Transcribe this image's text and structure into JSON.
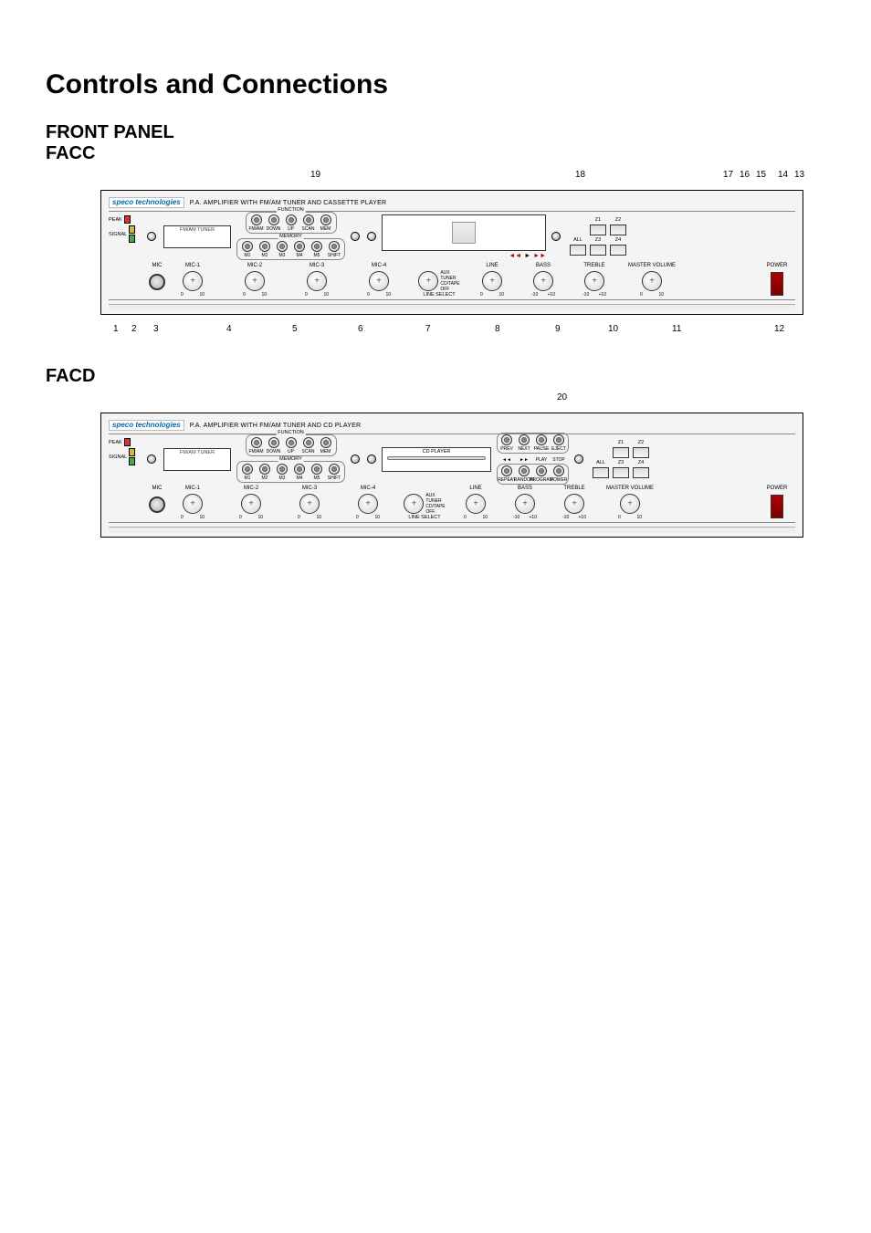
{
  "headings": {
    "title": "Controls and Connections",
    "front_panel": "FRONT PANEL",
    "facc": "FACC",
    "facd": "FACD"
  },
  "logo_text": "speco technologies",
  "facc": {
    "panel_title": "P.A. AMPLIFIER WITH FM/AM TUNER AND CASSETTE PLAYER",
    "callouts_top": [
      "19",
      "18",
      "17",
      "16",
      "15",
      "14",
      "13"
    ],
    "callouts_bottom": [
      "1",
      "2",
      "3",
      "4",
      "5",
      "6",
      "7",
      "8",
      "9",
      "10",
      "11",
      "12"
    ],
    "leds": {
      "peak": "PEAK",
      "signal": "SIGNAL"
    },
    "tuner_label": "FM/AM TUNER",
    "function_group": {
      "label": "FUNCTION",
      "buttons": [
        "FM/AM",
        "DOWN",
        "UP",
        "SCAN",
        "MEM"
      ]
    },
    "memory_group": {
      "label": "MEMORY",
      "buttons": [
        "M1",
        "M2",
        "M3",
        "M4",
        "M5",
        "SHIFT"
      ]
    },
    "transport": [
      "◄◄",
      "►",
      "►►",
      "■"
    ],
    "knobs": {
      "mic_jack": "MIC",
      "mic1": "MIC-1",
      "mic2": "MIC-2",
      "mic3": "MIC-3",
      "mic4": "MIC-4",
      "line_select": "LINE SELECT",
      "line": "LINE",
      "bass": "BASS",
      "treble": "TREBLE",
      "master": "MASTER VOLUME",
      "power": "POWER",
      "aux_labels": [
        "AUX",
        "TUNER",
        "CD/TAPE",
        "OFF"
      ],
      "scale_0_10": [
        "0",
        "10"
      ],
      "scale_pm10": [
        "-10",
        "+10"
      ]
    },
    "zones": {
      "all": "ALL",
      "z1": "Z1",
      "z2": "Z2",
      "z3": "Z3",
      "z4": "Z4"
    }
  },
  "facd": {
    "panel_title": "P.A. AMPLIFIER WITH FM/AM TUNER AND CD PLAYER",
    "callouts_top": [
      "20"
    ],
    "cd_label": "CD PLAYER",
    "cd_group_top": {
      "buttons": [
        "PREV",
        "NEXT",
        "PAUSE",
        "EJECT"
      ]
    },
    "cd_group_mid": {
      "buttons": [
        "◄◄",
        "►►",
        "PLAY",
        "STOP"
      ]
    },
    "cd_group_bot": {
      "buttons": [
        "REPEAT",
        "RANDOM",
        "PROGRAM",
        "POWER"
      ]
    }
  }
}
